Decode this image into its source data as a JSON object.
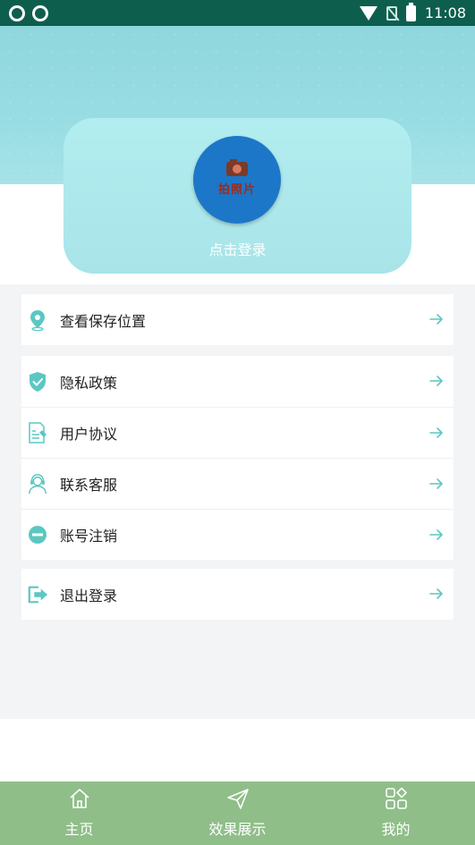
{
  "status_bar": {
    "time": "11:08",
    "left_icons": [
      "sync-icon",
      "sync-icon"
    ],
    "right_icons": [
      "wifi-icon",
      "no-sim-icon",
      "battery-icon"
    ]
  },
  "profile": {
    "avatar_logo_text": "拍照片",
    "login_label": "点击登录"
  },
  "menu_groups": [
    {
      "items": [
        {
          "label": "查看保存位置",
          "icon": "location-pin-icon"
        }
      ]
    },
    {
      "items": [
        {
          "label": "隐私政策",
          "icon": "shield-check-icon"
        },
        {
          "label": "用户协议",
          "icon": "document-icon"
        },
        {
          "label": "联系客服",
          "icon": "customer-service-icon"
        },
        {
          "label": "账号注销",
          "icon": "minus-circle-icon"
        }
      ]
    },
    {
      "items": [
        {
          "label": "退出登录",
          "icon": "logout-icon"
        }
      ]
    }
  ],
  "bottom_nav": [
    {
      "label": "主页",
      "icon": "home-icon"
    },
    {
      "label": "效果展示",
      "icon": "send-icon"
    },
    {
      "label": "我的",
      "icon": "grid-icon"
    }
  ],
  "colors": {
    "status_bar": "#0e5e4e",
    "accent": "#5cc7c2",
    "bottom_nav": "#8fbe89",
    "avatar_bg": "#1d77c8",
    "content_bg": "#f3f4f6"
  }
}
